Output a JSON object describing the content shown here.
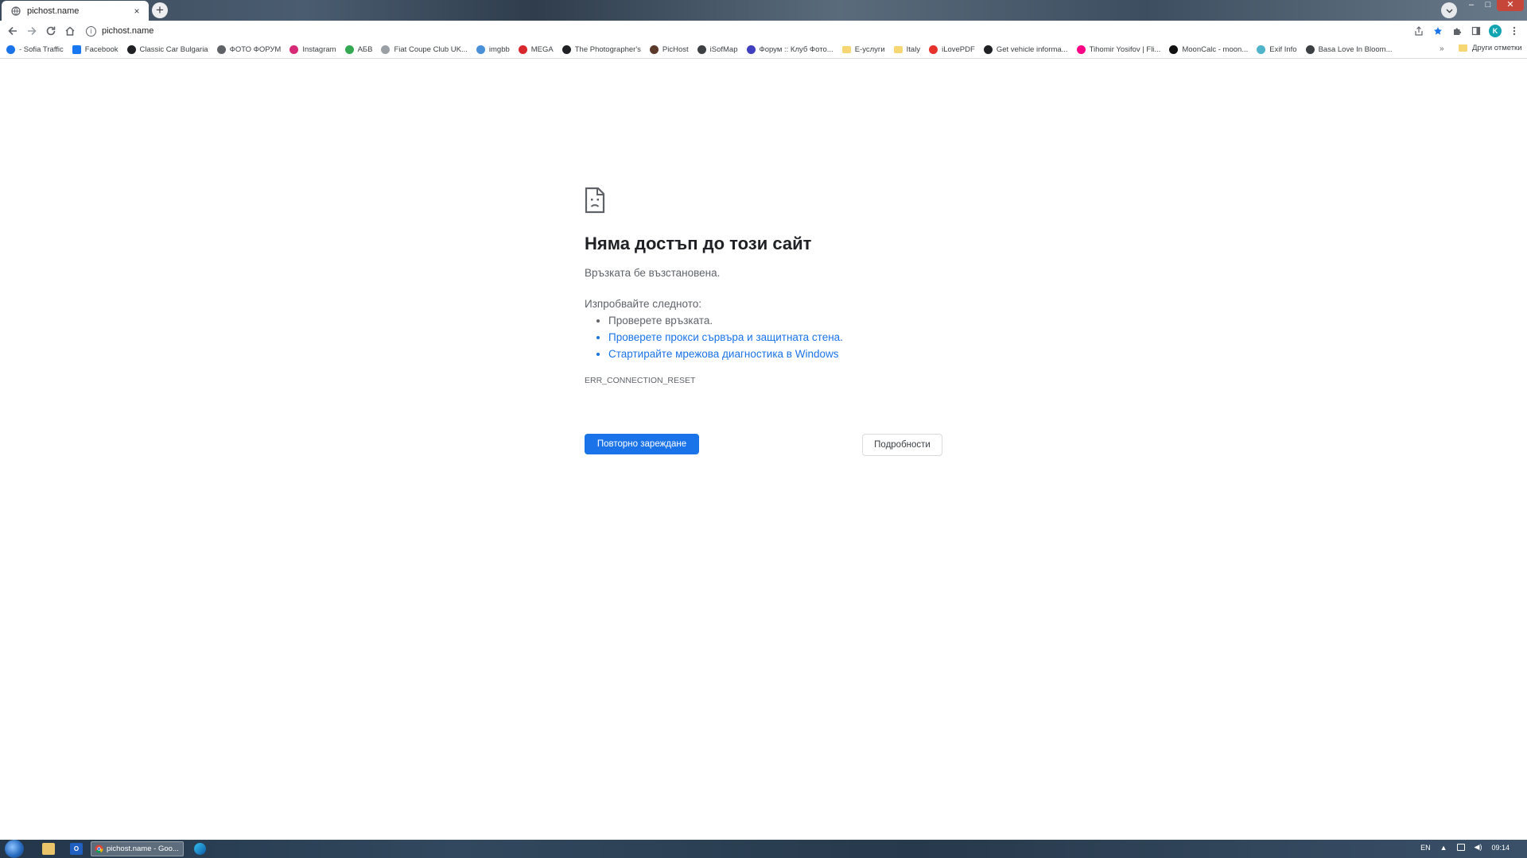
{
  "tab": {
    "title": "pichost.name",
    "close": "×",
    "new_tab": "+"
  },
  "window_controls": {
    "minimize": "–",
    "maximize": "□",
    "close": "✕"
  },
  "omnibox": {
    "url": "pichost.name",
    "info": "i"
  },
  "toolbar": {
    "profile_initial": "K"
  },
  "bookmarks": [
    {
      "label": "- Sofia Traffic",
      "icon": "sofia-traffic-icon",
      "color": "#1a73e8"
    },
    {
      "label": "Facebook",
      "icon": "facebook-icon",
      "color": "#1877f2"
    },
    {
      "label": "Classic Car Bulgaria",
      "icon": "car-icon",
      "color": "#202124"
    },
    {
      "label": "ФОТО ФОРУМ",
      "icon": "feather-icon",
      "color": "#5f6368"
    },
    {
      "label": "Instagram",
      "icon": "instagram-icon",
      "color": "#d62976"
    },
    {
      "label": "АБВ",
      "icon": "abv-icon",
      "color": "#34a853"
    },
    {
      "label": "Fiat Coupe Club UK...",
      "icon": "fiat-icon",
      "color": "#9aa0a6"
    },
    {
      "label": "imgbb",
      "icon": "imgbb-icon",
      "color": "#4a90d9"
    },
    {
      "label": "MEGA",
      "icon": "mega-icon",
      "color": "#d9272e"
    },
    {
      "label": "The Photographer's",
      "icon": "photographer-icon",
      "color": "#202124"
    },
    {
      "label": "PicHost",
      "icon": "pichost-icon",
      "color": "#5b3a29"
    },
    {
      "label": "iSofMap",
      "icon": "globe-icon",
      "color": "#3c4043"
    },
    {
      "label": "Форум :: Клуб Фото...",
      "icon": "forum-icon",
      "color": "#3f3fbf"
    },
    {
      "label": "Е-услуги",
      "icon": "folder-icon",
      "color": "#f7d774"
    },
    {
      "label": "Italy",
      "icon": "folder-icon",
      "color": "#f7d774"
    },
    {
      "label": "iLovePDF",
      "icon": "ilovepdf-icon",
      "color": "#e5322d"
    },
    {
      "label": "Get vehicle informa...",
      "icon": "vehicle-info-icon",
      "color": "#202124"
    },
    {
      "label": "Tihomir Yosifov | Fli...",
      "icon": "flickr-icon",
      "color": "#ff0084"
    },
    {
      "label": "MoonCalc - moon...",
      "icon": "moon-icon",
      "color": "#111111"
    },
    {
      "label": "Exif Info",
      "icon": "exif-icon",
      "color": "#4fb3c9"
    },
    {
      "label": "Basa Love In Bloom...",
      "icon": "el-icon",
      "color": "#3c4043"
    }
  ],
  "bookmarks_more": "»",
  "other_bookmarks": "Други отметки",
  "error": {
    "title": "Няма достъп до този сайт",
    "description": "Връзката бе възстановена.",
    "suggest_heading": "Изпробвайте следното:",
    "suggestions": [
      "Проверете връзката.",
      "Проверете прокси сървъра и защитната стена.",
      "Стартирайте мрежова диагностика в Windows"
    ],
    "code": "ERR_CONNECTION_RESET",
    "reload_label": "Повторно зареждане",
    "details_label": "Подробности"
  },
  "taskbar": {
    "chrome_task_label": "pichost.name - Goo...",
    "language": "EN",
    "time": "09:14"
  },
  "colors": {
    "accent": "#1a73e8",
    "text": "#202124",
    "muted": "#5f6368"
  }
}
